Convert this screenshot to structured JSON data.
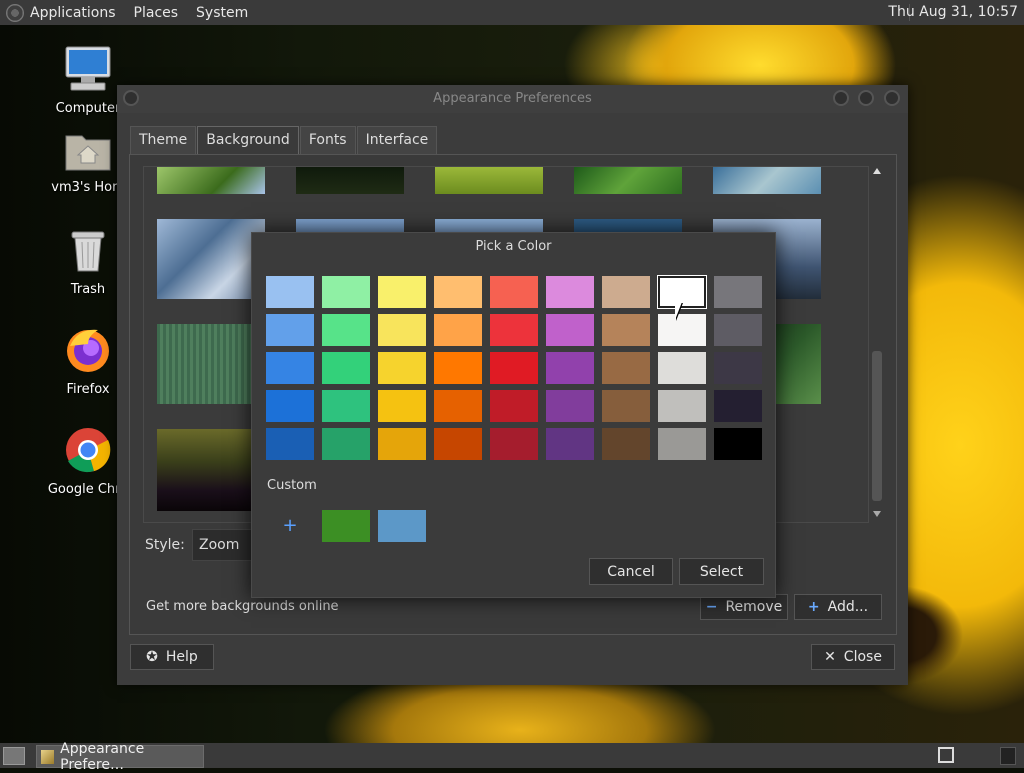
{
  "top_panel": {
    "menus": [
      "Applications",
      "Places",
      "System"
    ],
    "clock": "Thu Aug 31, 10:57"
  },
  "desktop_icons": [
    {
      "label": "Computer",
      "icon": "computer-icon"
    },
    {
      "label": "vm3's Hom",
      "icon": "home-folder-icon"
    },
    {
      "label": "Trash",
      "icon": "trash-icon"
    },
    {
      "label": "Firefox",
      "icon": "firefox-icon"
    },
    {
      "label": "Google Chro",
      "icon": "chrome-icon"
    }
  ],
  "taskbar": {
    "window_button": "Appearance Prefere…"
  },
  "appearance": {
    "title": "Appearance Preferences",
    "tabs": [
      "Theme",
      "Background",
      "Fonts",
      "Interface"
    ],
    "active_tab": "Background",
    "style_label": "Style:",
    "style_value": "Zoom",
    "online_label": "Get more backgrounds online",
    "remove_label": "Remove",
    "add_label": "Add...",
    "help_label": "Help",
    "close_label": "Close"
  },
  "color_dialog": {
    "title": "Pick a Color",
    "palette": [
      [
        "#99c1f1",
        "#8ff0a4",
        "#f9f06b",
        "#ffbe6f",
        "#f66151",
        "#dc8add",
        "#cdab8f",
        "#ffffff",
        "#77767b"
      ],
      [
        "#62a0ea",
        "#57e389",
        "#f8e45c",
        "#ffa348",
        "#ed333b",
        "#c061cb",
        "#b5835a",
        "#f6f5f4",
        "#5e5c64"
      ],
      [
        "#3584e4",
        "#33d17a",
        "#f6d32d",
        "#ff7800",
        "#e01b24",
        "#9141ac",
        "#986a44",
        "#deddda",
        "#3d3846"
      ],
      [
        "#1c71d8",
        "#2ec27e",
        "#f5c211",
        "#e66100",
        "#c01c28",
        "#813d9c",
        "#865e3c",
        "#c0bfbc",
        "#241f31"
      ],
      [
        "#1a5fb4",
        "#26a269",
        "#e5a50a",
        "#c64600",
        "#a51d2d",
        "#613583",
        "#63452c",
        "#9a9996",
        "#000000"
      ]
    ],
    "selected_color": "#ffffff",
    "custom_label": "Custom",
    "custom_add_symbol": "+",
    "custom_colors": [
      "#3c8f24",
      "#5c98c8"
    ],
    "cancel_label": "Cancel",
    "select_label": "Select"
  }
}
